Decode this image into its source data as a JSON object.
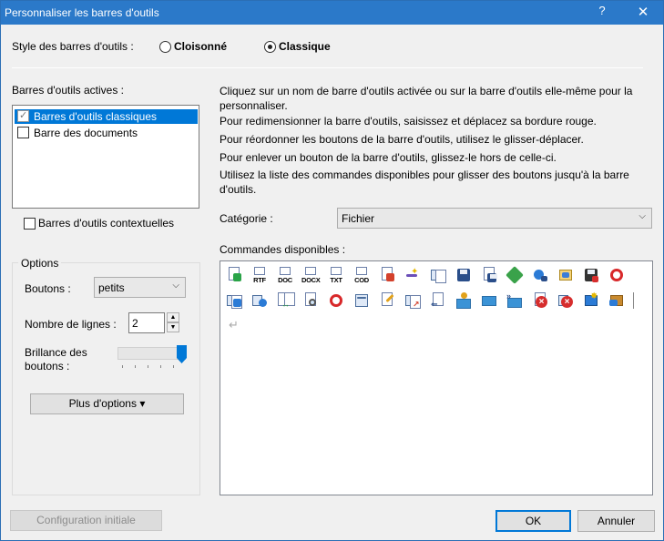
{
  "window": {
    "title": "Personnaliser les barres d'outils",
    "help_glyph": "?",
    "close_glyph": "✕"
  },
  "style_row": {
    "label": "Style des barres d'outils :",
    "option_cloisonne": "Cloisonné",
    "option_classique": "Classique",
    "selected": "Classique"
  },
  "active_toolbars": {
    "label": "Barres d'outils actives :",
    "items": [
      {
        "label": "Barres d'outils classiques",
        "checked": true,
        "selected": true
      },
      {
        "label": "Barre des documents",
        "checked": false,
        "selected": false
      }
    ],
    "contextual_label": "Barres d'outils contextuelles"
  },
  "options": {
    "group_label": "Options",
    "buttons_label": "Boutons :",
    "buttons_value": "petits",
    "lines_label": "Nombre de lignes :",
    "lines_value": "2",
    "brightness_label_1": "Brillance des",
    "brightness_label_2": "boutons :",
    "brightness_level": 1.0,
    "more_options_label": "Plus d'options ▾"
  },
  "help": {
    "p1": "Cliquez sur un nom de barre d'outils activée ou sur la barre d'outils elle-même pour la personnaliser.",
    "p2": "Pour redimensionner la barre d'outils, saisissez et déplacez sa bordure rouge.",
    "p3": "Pour réordonner les boutons de la barre d'outils, utilisez le glisser-déplacer.",
    "p4": "Pour enlever un bouton de la barre d'outils, glissez-le hors de celle-ci.",
    "p5": "Utilisez la liste des commandes disponibles pour glisser des boutons jusqu'à la barre d'outils."
  },
  "category": {
    "label": "Catégorie :",
    "value": "Fichier"
  },
  "commands": {
    "label": "Commandes disponibles :",
    "row1": [
      "new-doc-icon",
      "RTF",
      "DOC",
      "DOCX",
      "TXT",
      "COD",
      "open-check-icon",
      "wand-icon",
      "copy-doc-icon",
      "save-icon",
      "save-as-icon",
      "export-icon",
      "globe-icon",
      "frame-icon",
      "save-red-icon",
      "lifebuoy-icon"
    ],
    "row2": [
      "multi-doc-icon",
      "gear-doc-icon",
      "merge-doc-icon",
      "search-doc-icon",
      "lifebuoy-icon",
      "properties-icon",
      "edit-doc-icon",
      "move-doc-icon",
      "import-doc-icon",
      "mail-person-icon",
      "mail-icon",
      "mail-send-icon",
      "close-doc-icon",
      "close-red-icon",
      "new-star-icon",
      "package-icon"
    ],
    "return_glyph": "↵"
  },
  "footer": {
    "reset_label": "Configuration initiale",
    "ok_label": "OK",
    "cancel_label": "Annuler"
  }
}
